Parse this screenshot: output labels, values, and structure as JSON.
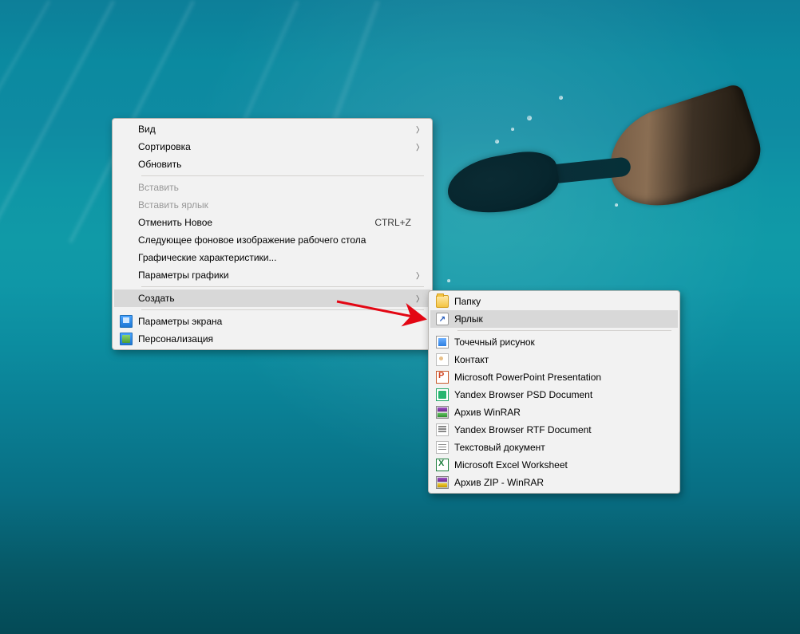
{
  "primary_menu": {
    "view": {
      "label": "Вид"
    },
    "sort": {
      "label": "Сортировка"
    },
    "refresh": {
      "label": "Обновить"
    },
    "paste": {
      "label": "Вставить"
    },
    "paste_short": {
      "label": "Вставить ярлык"
    },
    "undo": {
      "label": "Отменить Новое",
      "shortcut": "CTRL+Z"
    },
    "next_bg": {
      "label": "Следующее фоновое изображение рабочего стола"
    },
    "gfx_chars": {
      "label": "Графические характеристики..."
    },
    "gfx_params": {
      "label": "Параметры графики"
    },
    "create": {
      "label": "Создать"
    },
    "display": {
      "label": "Параметры экрана"
    },
    "personal": {
      "label": "Персонализация"
    }
  },
  "create_submenu": {
    "folder": {
      "label": "Папку"
    },
    "shortcut": {
      "label": "Ярлык"
    },
    "bmp": {
      "label": "Точечный рисунок"
    },
    "contact": {
      "label": "Контакт"
    },
    "ppt": {
      "label": "Microsoft PowerPoint Presentation"
    },
    "psd": {
      "label": "Yandex Browser PSD Document"
    },
    "rar": {
      "label": "Архив WinRAR"
    },
    "rtf": {
      "label": "Yandex Browser RTF Document"
    },
    "txt": {
      "label": "Текстовый документ"
    },
    "xls": {
      "label": "Microsoft Excel Worksheet"
    },
    "zip": {
      "label": "Архив ZIP - WinRAR"
    }
  }
}
